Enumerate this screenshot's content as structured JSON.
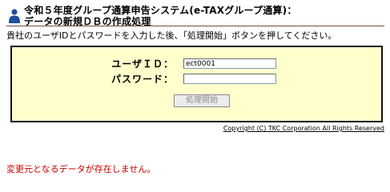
{
  "header": {
    "title_line1": "令和５年度グループ通算申告システム(e-TAXグループ通算)：",
    "title_line2": "データの新規ＤＢの作成処理",
    "logo_icon": "person-icon"
  },
  "instruction": "貴社のユーザIDとパスワードを入力した後、「処理開始」ボタンを押してください。",
  "login": {
    "user_label": "ユーザＩＤ：",
    "user_value": "ect0001",
    "password_label": "パスワード：",
    "password_value": "",
    "submit_label": "処理開始"
  },
  "copyright": "Copyright (C) TKC Corporation All Rights Reserved",
  "error_message": "変更元となるデータが存在しません。",
  "colors": {
    "panel_background": "#ffffcc",
    "logo_blue": "#1f4e9c",
    "error_red": "#cc0000",
    "rule": "#7a4a3a"
  }
}
